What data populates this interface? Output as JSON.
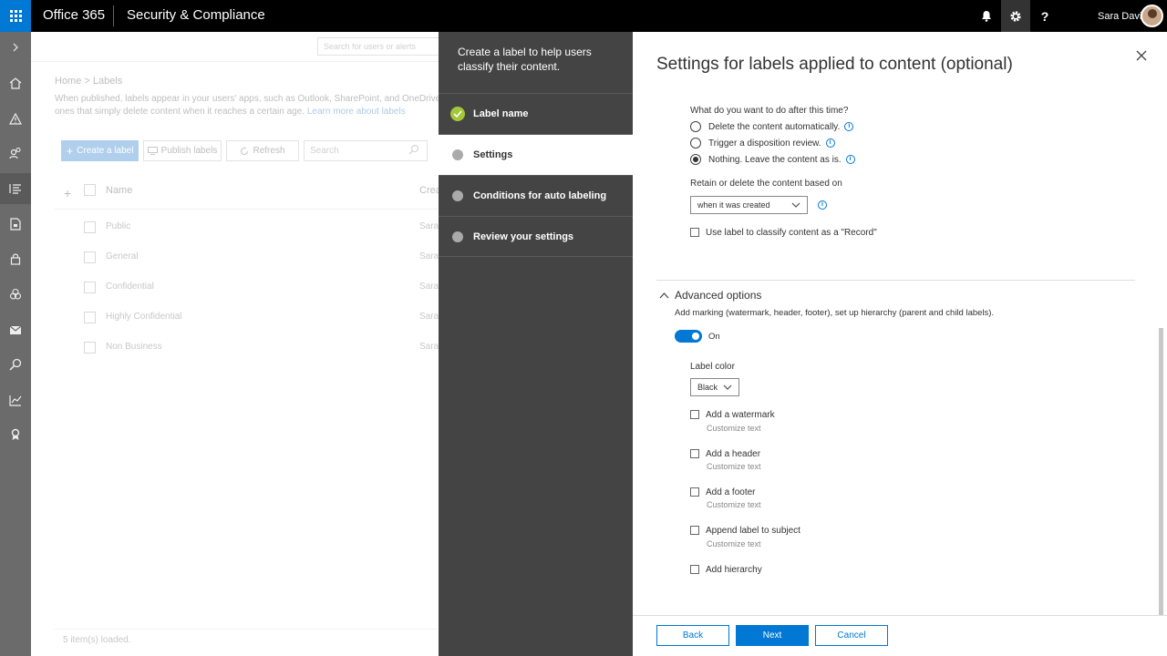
{
  "topbar": {
    "brand": "Office 365",
    "app_title": "Security & Compliance",
    "user_name": "Sara Davis"
  },
  "background": {
    "search_placeholder": "Search for users or alerts",
    "breadcrumb": "Home  >  Labels",
    "desc_line1": "When published, labels appear in your users' apps, such as Outlook, SharePoint, and OneDrive. When a",
    "desc_line2": "ones that simply delete content when it reaches a certain age.",
    "learn_more": "Learn more about labels",
    "create_label": "Create a label",
    "publish_labels": "Publish labels",
    "refresh": "Refresh",
    "search_placeholder2": "Search",
    "col_name": "Name",
    "col_created": "Crea",
    "rows": [
      {
        "name": "Public",
        "created": "Sara"
      },
      {
        "name": "General",
        "created": "Sara"
      },
      {
        "name": "Confidential",
        "created": "Sara"
      },
      {
        "name": "Highly Confidential",
        "created": "Sara"
      },
      {
        "name": "Non Business",
        "created": "Sara"
      }
    ],
    "footer": "5 item(s) loaded."
  },
  "wizard": {
    "intro": "Create a label to help users classify their content.",
    "steps": [
      {
        "label": "Label name",
        "state": "done"
      },
      {
        "label": "Settings",
        "state": "current"
      },
      {
        "label": "Conditions for auto labeling",
        "state": "pending"
      },
      {
        "label": "Review your settings",
        "state": "pending"
      }
    ]
  },
  "content": {
    "title": "Settings for labels applied to content (optional)",
    "after_question": "What do you want to do after this time?",
    "radio_options": [
      {
        "label": "Delete the content automatically.",
        "selected": false
      },
      {
        "label": "Trigger a disposition review.",
        "selected": false
      },
      {
        "label": "Nothing. Leave the content as is.",
        "selected": true
      }
    ],
    "retain_based_label": "Retain or delete the content based on",
    "retain_based_value": "when it was created",
    "record_checkbox": "Use label to classify content as a \"Record\"",
    "advanced_title": "Advanced options",
    "advanced_desc": "Add marking (watermark, header, footer), set up hierarchy (parent and child labels).",
    "toggle_label": "On",
    "label_color_label": "Label color",
    "label_color_value": "Black",
    "markings": [
      {
        "label": "Add a watermark",
        "sub": "Customize text"
      },
      {
        "label": "Add a header",
        "sub": "Customize text"
      },
      {
        "label": "Add a footer",
        "sub": "Customize text"
      },
      {
        "label": "Append label to subject",
        "sub": "Customize text"
      },
      {
        "label": "Add hierarchy",
        "sub": ""
      }
    ],
    "back": "Back",
    "next": "Next",
    "cancel": "Cancel"
  },
  "colors": {
    "accent": "#0078d4",
    "wizard_bg": "#444444",
    "done_check": "#a4c639"
  }
}
